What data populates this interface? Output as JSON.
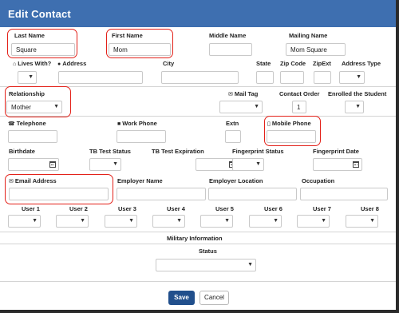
{
  "dialog": {
    "title": "Edit Contact"
  },
  "name_row": {
    "last_name_label": "Last Name",
    "last_name_value": "Square",
    "first_name_label": "First Name",
    "first_name_value": "Mom",
    "middle_name_label": "Middle Name",
    "middle_name_value": "",
    "mailing_name_label": "Mailing Name",
    "mailing_name_value": "Mom Square"
  },
  "address_row": {
    "lives_with_label": "Lives With?",
    "address_label": "Address",
    "city_label": "City",
    "state_label": "State",
    "zip_label": "Zip Code",
    "zipext_label": "ZipExt",
    "address_type_label": "Address Type"
  },
  "relationship_row": {
    "relationship_label": "Relationship",
    "relationship_value": "Mother",
    "mail_tag_label": "Mail Tag",
    "contact_order_label": "Contact Order",
    "contact_order_value": "1",
    "enrolled_label": "Enrolled the Student"
  },
  "phone_row": {
    "telephone_label": "Telephone",
    "work_phone_label": "Work Phone",
    "extn_label": "Extn",
    "mobile_phone_label": "Mobile Phone"
  },
  "status_row": {
    "birthdate_label": "Birthdate",
    "tb_status_label": "TB Test Status",
    "tb_expiration_label": "TB Test Expiration",
    "fingerprint_status_label": "Fingerprint Status",
    "fingerprint_date_label": "Fingerprint Date"
  },
  "email_row": {
    "email_label": "Email Address",
    "employer_name_label": "Employer Name",
    "employer_location_label": "Employer Location",
    "occupation_label": "Occupation"
  },
  "user_fields": [
    "User 1",
    "User 2",
    "User 3",
    "User 4",
    "User 5",
    "User 6",
    "User 7",
    "User 8"
  ],
  "military": {
    "section_title": "Military Information",
    "status_label": "Status"
  },
  "buttons": {
    "save": "Save",
    "cancel": "Cancel"
  },
  "colors": {
    "titlebar": "#3e6fb0",
    "save_button": "#214f8c",
    "highlight": "#e32119"
  }
}
